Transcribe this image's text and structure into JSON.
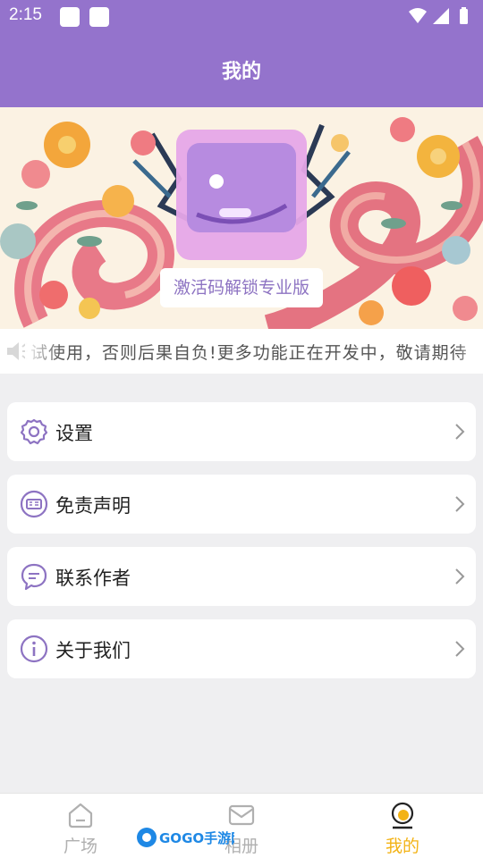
{
  "status_bar": {
    "time": "2:15"
  },
  "app_bar": {
    "title": "我的"
  },
  "banner": {
    "unlock_label": "激活码解锁专业版"
  },
  "notice": {
    "text": "试使用，否则后果自负!更多功能正在开发中，敬请期待"
  },
  "menu": {
    "items": [
      {
        "label": "设置",
        "icon": "gear-icon"
      },
      {
        "label": "免责声明",
        "icon": "notice-icon"
      },
      {
        "label": "联系作者",
        "icon": "chat-icon"
      },
      {
        "label": "关于我们",
        "icon": "info-icon"
      }
    ]
  },
  "bottom_nav": {
    "items": [
      {
        "label": "广场",
        "icon": "home-icon",
        "active": false
      },
      {
        "label": "相册",
        "icon": "mail-icon",
        "active": false
      },
      {
        "label": "我的",
        "icon": "profile-icon",
        "active": true
      }
    ]
  },
  "watermark": {
    "text": "GOGO手游网"
  },
  "colors": {
    "primary": "#9473cc",
    "active": "#f3b316",
    "background": "#efeff1"
  }
}
